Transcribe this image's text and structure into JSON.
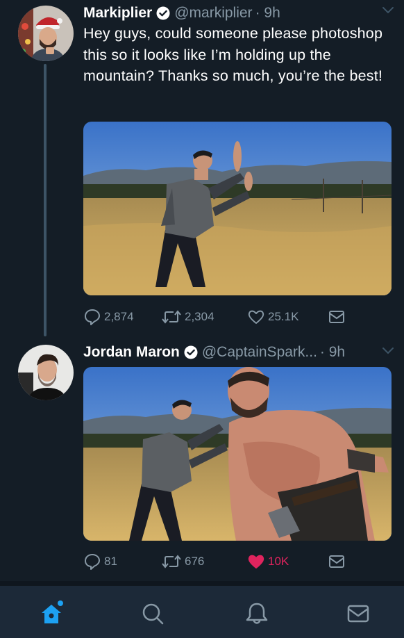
{
  "tweets": [
    {
      "name": "Markiplier",
      "handle": "@markiplier",
      "time": "9h",
      "text": "Hey guys, could someone please photoshop this so it looks like I’m holding up the mountain? Thanks so much, you’re the best!",
      "replies": "2,874",
      "retweets": "2,304",
      "likes": "25.1K",
      "liked": false
    },
    {
      "name": "Jordan Maron",
      "handle": "@CaptainSpark...",
      "time": "9h",
      "text": "",
      "replies": "81",
      "retweets": "676",
      "likes": "10K",
      "liked": true
    }
  ],
  "colors": {
    "background": "#141d26",
    "secondary_text": "#8899a6",
    "accent": "#1da1f2",
    "like": "#e0245e",
    "tabbar": "#1c2938"
  },
  "tabs": [
    {
      "icon": "home-icon",
      "active": true,
      "notification_dot": true
    },
    {
      "icon": "search-icon",
      "active": false
    },
    {
      "icon": "bell-icon",
      "active": false
    },
    {
      "icon": "mail-icon",
      "active": false
    }
  ]
}
